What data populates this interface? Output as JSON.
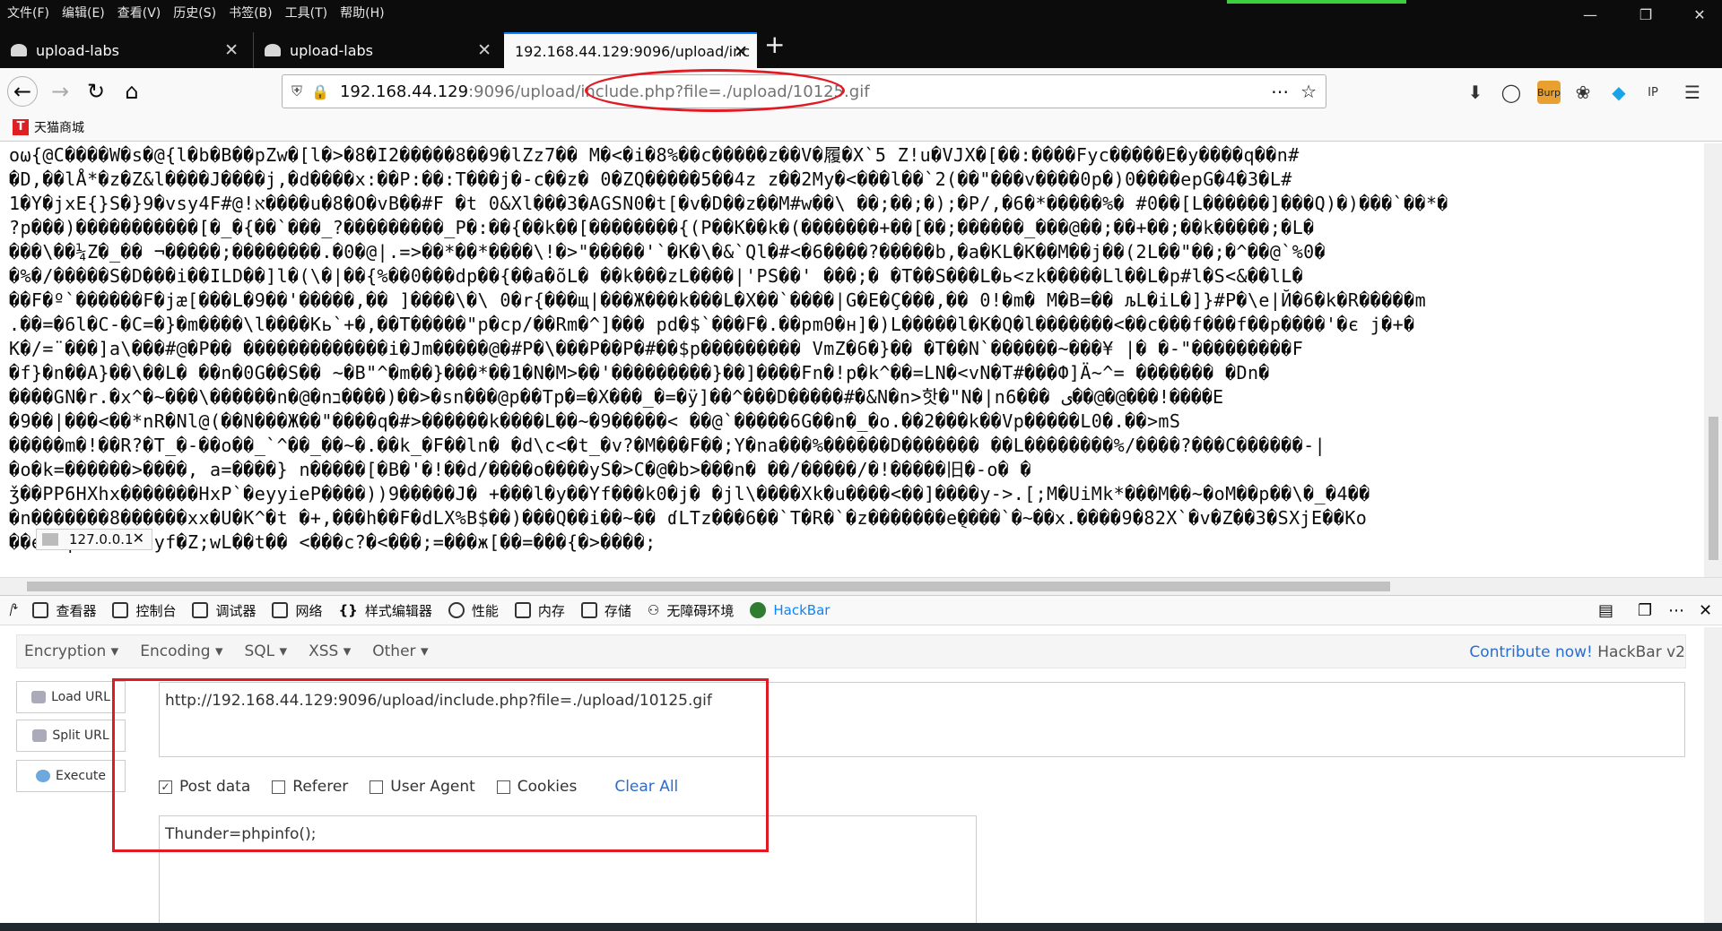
{
  "menu": [
    "文件(F)",
    "编辑(E)",
    "查看(V)",
    "历史(S)",
    "书签(B)",
    "工具(T)",
    "帮助(H)"
  ],
  "tabs": [
    {
      "label": "upload-labs"
    },
    {
      "label": "upload-labs"
    },
    {
      "label": "192.168.44.129:9096/upload/inc"
    }
  ],
  "url": {
    "host": "192.168.44.129",
    "rest": ":9096/upload/include.php?file=./upload/10125.gif"
  },
  "bookmark": {
    "label": "天猫商城",
    "logo": "T"
  },
  "content_lines": [
    "oω{@C����W�s�@{l�b�B��pZw�[l�>�8�I2�����8��9�lZz7�� M�<�i�8%��c�����z��V�履�X`5 Z!u�VJX�[��:����Fyc�����E�y����q��n#",
    "�D,��lÅ*�z�Z&l����J����j,�d����x:��P:��:T���j�-c��z� 0�ZQ�����5��4z z��2My�<���l��`2(��\"���v����0p�)0����epG�4�3�L#",
    "1�Y�jxE{}S�}9�vsy4F#@!א����u�8�O�vB��#F �t 0&Xl���3�AGSN0�t[�v�D��z��M#w��\\ ��;��;�);�P/,�6�*�����%� #0��[L������]���Q)�)���`��*�",
    "?p���)�����������[�_�{��`���_?���������_P�:��{��k��[��������{(P��K��k�(�������+��[��;������_���@��;��+��;��k�����;�L�",
    "���\\��¼Z�_�� ¬�����;��������.�0�@|.=>��*��*����\\!�>\"�����'`�K�\\�&`Ql�#<�6����?�����b,�a�KL�K��M��j��(2L��\"��;�^��@`%0�",
    "�%�/�����S�D���i��ILD��]l�(\\�|��{%��0���dp��{��a�õL� ��k���zL����|'PS��' ���;� �T��S���L�ь<zk�����Ll��L�p#l�S<&��lL�",
    "��F�º`������F�jæ[���L�9��'�����,�� ]����\\�\\ 0�r{���щ|���Ж���k���L�X��`����|G�E�Ç���,�� 0!�m� M�B=�� љL�iL�]}#P�\\e|Й�6�k�R�����m",
    ".��=�6l�C-�C=�}�m����\\l����Kь`+�,��T�����\"p�cp/��Rm�^]��� pd�$`���F�.��pmΘ�н]�)L�����l�K�Q�l�������<��c���f���f��p����'�є ј�+�",
    "K�/=¨���]a\\���#@�P�� �������������i�Jm�����@�#P�\\���P��P�#��$p��������� VmZ�6�}�� �T��N`������~���¥ |� �-\"���������F",
    "�f}�n��A}��\\��L� ��n�0G��S�� ~�B\"^�m��}���*��1�N�M>��'���������}��]����Fn�!p�k^��=LN�<vN�T#���Ф]Ä~^= ������� �Dn�",
    "����GN�r.�x^�~���\\������n�@�nב����)��>�sn���@p��Tp�=�X���_�=�ӱ]��^���D�����#�&N�n>핫�\"N�|n6��� ی��@�@���!����E",
    "�9��|���<��*nR�Nl@(��N���Ж��\"����q�#>������k����L��~�9�����< ��@`�����6G��n�_�o.��2���k��Vp�����L0�.��>mS",
    "�����m�!��R?�T_�-��o��_`^��_��~�.��k_�F��ln� �d\\c<�t_�v?�M���F��;Y�na���%������D������� ��L��������%/����?���C������-|",
    "�o�k=������>����, a=����} n�����[�B�'�!��d/����o����yS�>C�@�b>���n� ��/�����/�!�����旧�-o� �",
    "ǯ��PP6HXhx�������HxP`�eyyieP����))9�����J� +���l�y��Yf���k0�j� �jl\\����Xk�u����<��]����y->.[;M�UiMk*���M��~�oM��p��\\�_�4��",
    "�n�������8������xx�U�K^�t �+,���h��F�dLX%B$��)���Q��i��~�� ɗLTz���6��`T�R�`�z�������e݈����`�~��x.����9�82X`�v�Z��3�SXjE��Ko",
    "��enA|/ ���P\"yf�Z;wL��t�� <���c?�<���;=���ж[��=���{�>����;"
  ],
  "tooltip": "127.0.0.1",
  "devtools": {
    "tabs": [
      "查看器",
      "控制台",
      "调试器",
      "网络",
      "样式编辑器",
      "性能",
      "内存",
      "存储",
      "无障碍环境",
      "HackBar"
    ],
    "active": "HackBar"
  },
  "hackbar": {
    "menu": [
      "Encryption",
      "Encoding",
      "SQL",
      "XSS",
      "Other"
    ],
    "contribute_link": "Contribute now!",
    "contribute_rest": " HackBar v2",
    "buttons": {
      "load": "Load URL",
      "split": "Split URL",
      "execute": "Execute"
    },
    "url_value": "http://192.168.44.129:9096/upload/include.php?file=./upload/10125.gif",
    "checks": {
      "post": "Post data",
      "referer": "Referer",
      "useragent": "User Agent",
      "cookies": "Cookies"
    },
    "post_checked": true,
    "clear": "Clear All",
    "post_value": "Thunder=phpinfo();"
  },
  "colors": {
    "highlight": "#e01b24",
    "accent": "#0a84ff",
    "link": "#2b6dcc"
  }
}
